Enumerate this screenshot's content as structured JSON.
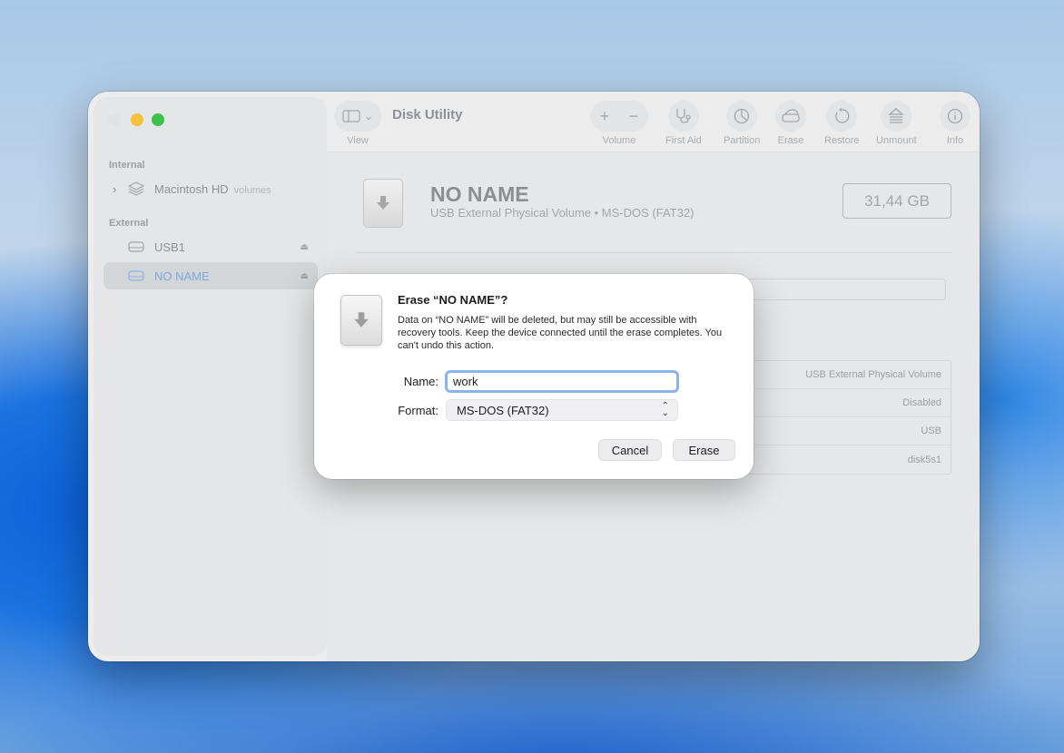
{
  "window": {
    "title": "Disk Utility"
  },
  "sidebar": {
    "internal_header": "Internal",
    "external_header": "External",
    "internal_items": [
      {
        "label": "Macintosh HD",
        "sub": "volumes"
      }
    ],
    "external_items": [
      {
        "label": "USB1",
        "eject": "⏏"
      },
      {
        "label": "NO NAME",
        "eject": "⏏",
        "selected": true
      }
    ]
  },
  "toolbar": {
    "view_label": "View",
    "volume_label": "Volume",
    "first_aid_label": "First Aid",
    "partition_label": "Partition",
    "erase_label": "Erase",
    "restore_label": "Restore",
    "unmount_label": "Unmount",
    "info_label": "Info"
  },
  "volume": {
    "name": "NO NAME",
    "description": "USB External Physical Volume • MS-DOS (FAT32)",
    "capacity": "31,44 GB"
  },
  "info_rows": [
    "USB External Physical Volume",
    "Disabled",
    "USB",
    "disk5s1"
  ],
  "dialog": {
    "title": "Erase “NO NAME”?",
    "body": "Data on “NO NAME” will be deleted, but may still be accessible with recovery tools. Keep the device connected until the erase completes. You can't undo this action.",
    "name_label": "Name:",
    "name_value": "work",
    "format_label": "Format:",
    "format_value": "MS-DOS (FAT32)",
    "cancel_label": "Cancel",
    "erase_label": "Erase"
  }
}
